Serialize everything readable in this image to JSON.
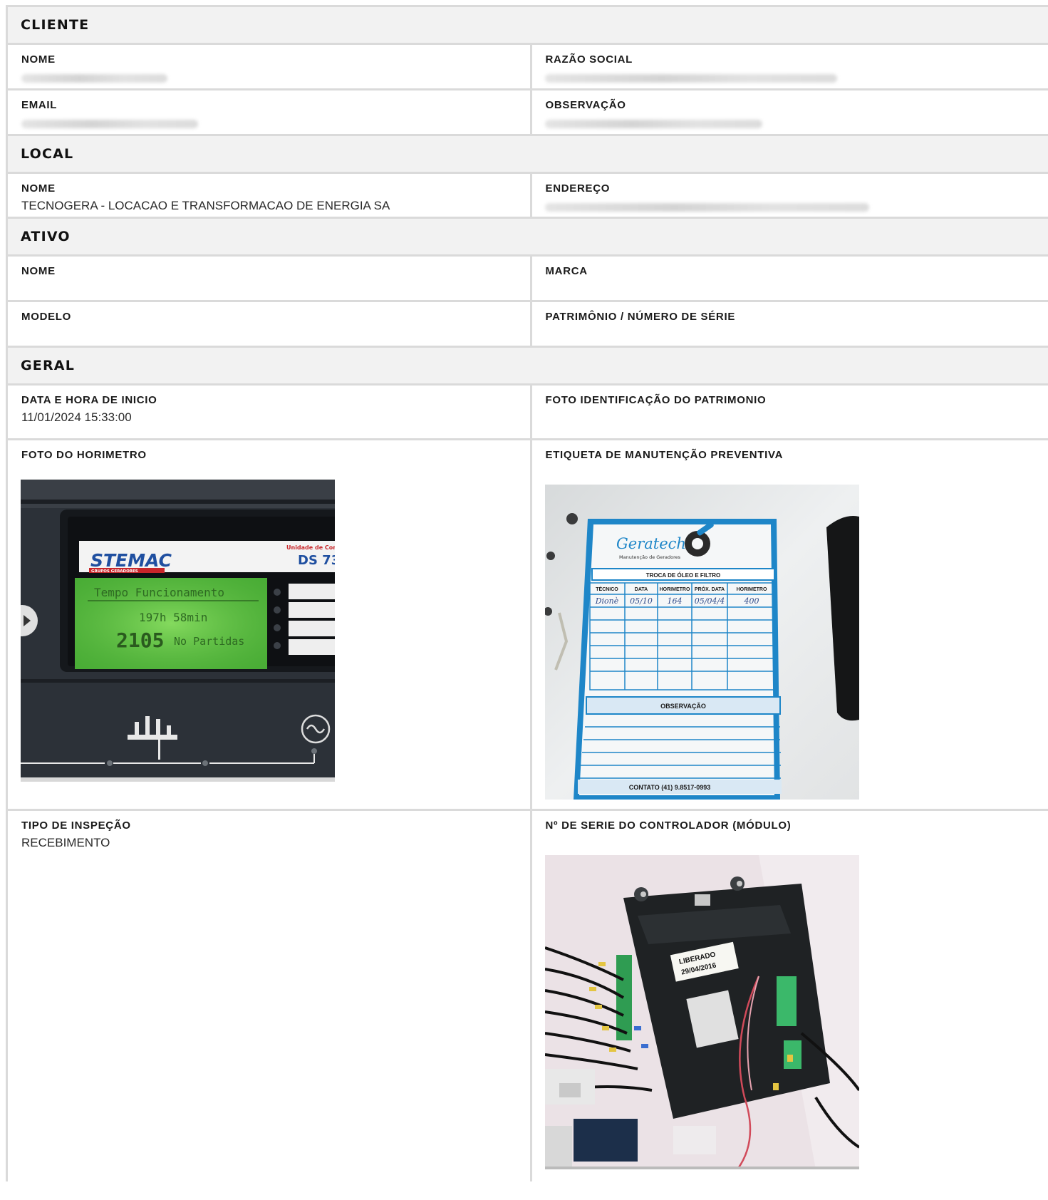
{
  "cliente": {
    "title": "CLIENTE",
    "nome_label": "NOME",
    "razao_label": "RAZÃO SOCIAL",
    "email_label": "EMAIL",
    "obs_label": "OBSERVAÇÃO"
  },
  "local": {
    "title": "LOCAL",
    "nome_label": "NOME",
    "nome_value": "TECNOGERA - LOCACAO E TRANSFORMACAO DE ENERGIA SA",
    "endereco_label": "ENDEREÇO"
  },
  "ativo": {
    "title": "ATIVO",
    "nome_label": "NOME",
    "marca_label": "MARCA",
    "modelo_label": "MODELO",
    "patrimonio_label": "PATRIMÔNIO / NÚMERO DE SÉRIE"
  },
  "geral": {
    "title": "GERAL",
    "inicio_label": "DATA E HORA DE INICIO",
    "inicio_value": "11/01/2024 15:33:00",
    "foto_patrimonio_label": "FOTO IDENTIFICAÇÃO DO PATRIMONIO",
    "horimetro_label": "FOTO DO HORIMETRO",
    "etiqueta_label": "ETIQUETA DE MANUTENÇÃO PREVENTIVA",
    "tipo_label": "TIPO DE INSPEÇÃO",
    "tipo_value": "RECEBIMENTO",
    "controlador_label": "Nº DE SERIE DO CONTROLADOR (MÓDULO)"
  },
  "photos": {
    "horimetro": {
      "brand": "STEMAC",
      "brand_sub": "GRUPOS GERADORES",
      "unit_label": "Unidade de Con",
      "model": "DS 73",
      "screen_line1": "Tempo Funcionamento",
      "screen_line2": "197h 58min",
      "screen_number": "2105",
      "screen_line3": "No Partidas"
    },
    "etiqueta": {
      "logo": "Geratech",
      "logo_sub": "Manutenção de Geradores",
      "title": "TROCA DE ÓLEO E FILTRO",
      "cols": [
        "TÉCNICO",
        "DATA",
        "HORIMETRO",
        "PRÓX. DATA",
        "HORIMETRO"
      ],
      "row1": [
        "Dionè",
        "05/10",
        "164",
        "05/04/4",
        "400"
      ],
      "obs": "OBSERVAÇÃO",
      "contato": "CONTATO (41) 9.8517-0993"
    },
    "controlador": {
      "sticker_line1": "LIBERADO",
      "sticker_line2": "29/04/2016"
    }
  }
}
